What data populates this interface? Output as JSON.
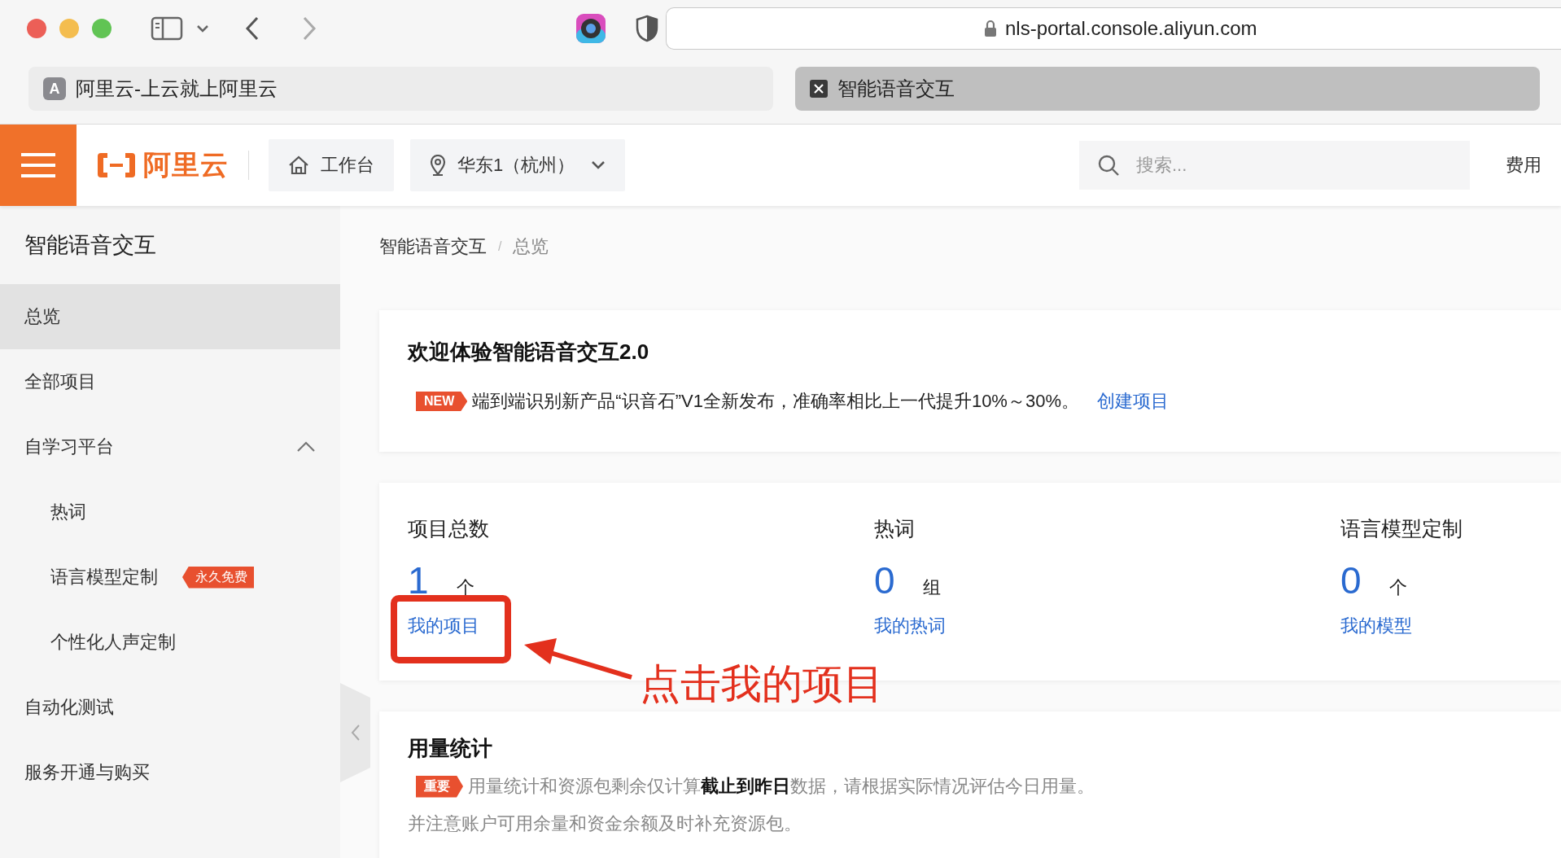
{
  "browser": {
    "url": "nls-portal.console.aliyun.com",
    "tabs": [
      {
        "label": "阿里云-上云就上阿里云",
        "favicon_letter": "A",
        "selected": false
      },
      {
        "label": "智能语音交互",
        "selected": true
      }
    ]
  },
  "console_header": {
    "logo_text": "阿里云",
    "workbench": "工作台",
    "region": "华东1（杭州）",
    "search": {
      "placeholder": "搜索..."
    },
    "link": "费用"
  },
  "sidebar": {
    "title": "智能语音交互",
    "items": [
      {
        "label": "总览",
        "selected": true
      },
      {
        "label": "全部项目",
        "selected": false
      },
      {
        "label": "自学习平台",
        "selected": false,
        "expanded": true,
        "children": [
          {
            "label": "热词",
            "selected": false
          },
          {
            "label": "语言模型定制",
            "selected": false,
            "badge": "永久免费"
          },
          {
            "label": "个性化人声定制",
            "selected": false
          }
        ]
      },
      {
        "label": "自动化测试",
        "selected": false
      },
      {
        "label": "服务开通与购买",
        "selected": false
      }
    ]
  },
  "breadcrumb": {
    "items": [
      "智能语音交互",
      "总览"
    ],
    "separator": "/"
  },
  "welcome": {
    "title": "欢迎体验智能语音交互2.0",
    "tag": "NEW",
    "text": "端到端识别新产品“识音石”V1全新发布，准确率相比上一代提升10%～30%。",
    "link": "创建项目"
  },
  "stats": [
    {
      "title": "项目总数",
      "value": "1",
      "unit": "个",
      "link": "我的项目"
    },
    {
      "title": "热词",
      "value": "0",
      "unit": "组",
      "link": "我的热词"
    },
    {
      "title": "语言模型定制",
      "value": "0",
      "unit": "个",
      "link": "我的模型"
    }
  ],
  "usage": {
    "title": "用量统计",
    "tag": "重要",
    "text": "用量统计和资源包剩余仅计算**截止到昨日**数据，请根据实际情况评估今日用量。",
    "note": "并注意账户可用余量和资金余额及时补充资源包。"
  },
  "annotation": {
    "text": "点击我的项目"
  }
}
